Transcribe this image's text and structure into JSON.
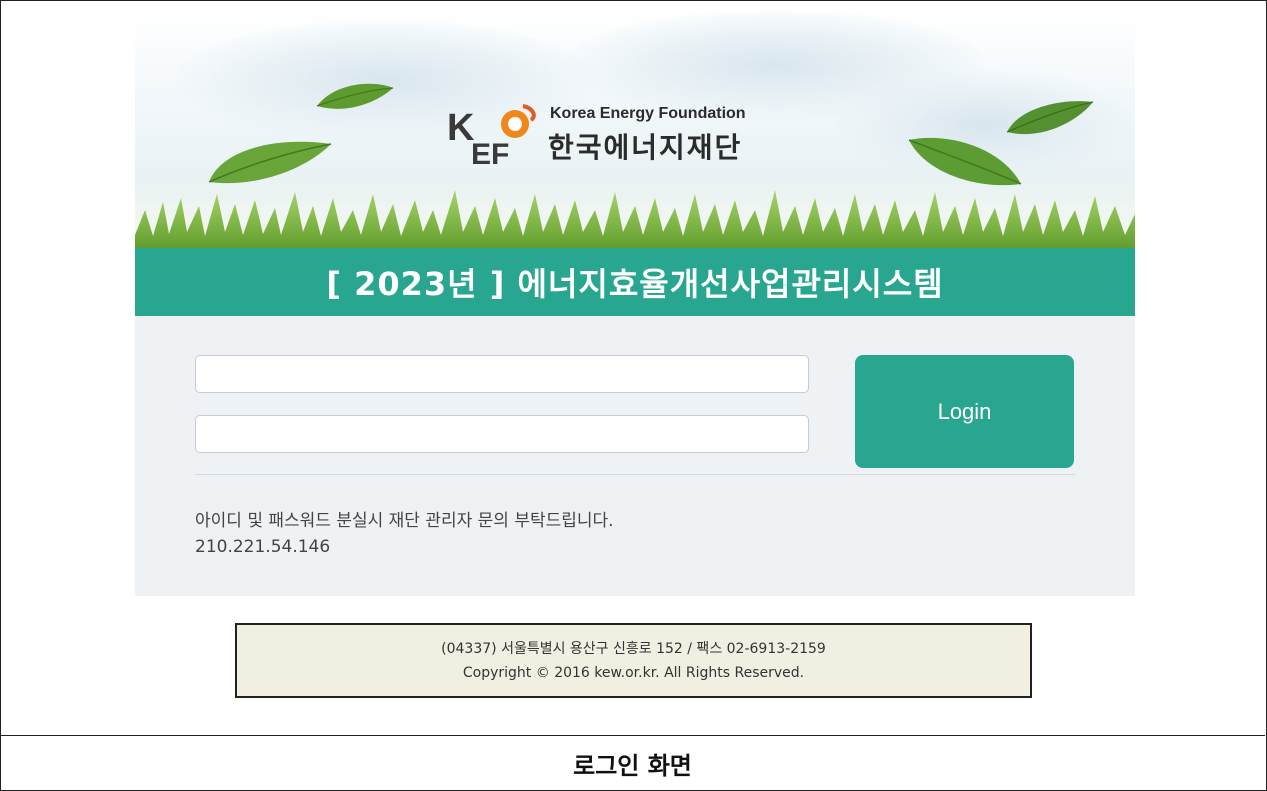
{
  "logo": {
    "english_name": "Korea Energy Foundation",
    "korean_name": "한국에너지재단",
    "brand_color": "#f08c1e"
  },
  "header": {
    "title": "[ 2023년 ] 에너지효율개선사업관리시스템"
  },
  "login_form": {
    "id_value": "",
    "password_value": "",
    "login_label": "Login",
    "help_text": "아이디 및 패스워드 분실시 재단 관리자 문의 부탁드립니다.",
    "ip_address": "210.221.54.146"
  },
  "footer": {
    "address": "(04337) 서울특별시 용산구 신흥로 152 / 팩스 02-6913-2159",
    "copyright": "Copyright © 2016 kew.or.kr. All Rights Reserved."
  },
  "caption": "로그인 화면",
  "colors": {
    "accent": "#28a690",
    "panel_bg": "#eef2f5",
    "footer_bg": "#f0efe2"
  }
}
